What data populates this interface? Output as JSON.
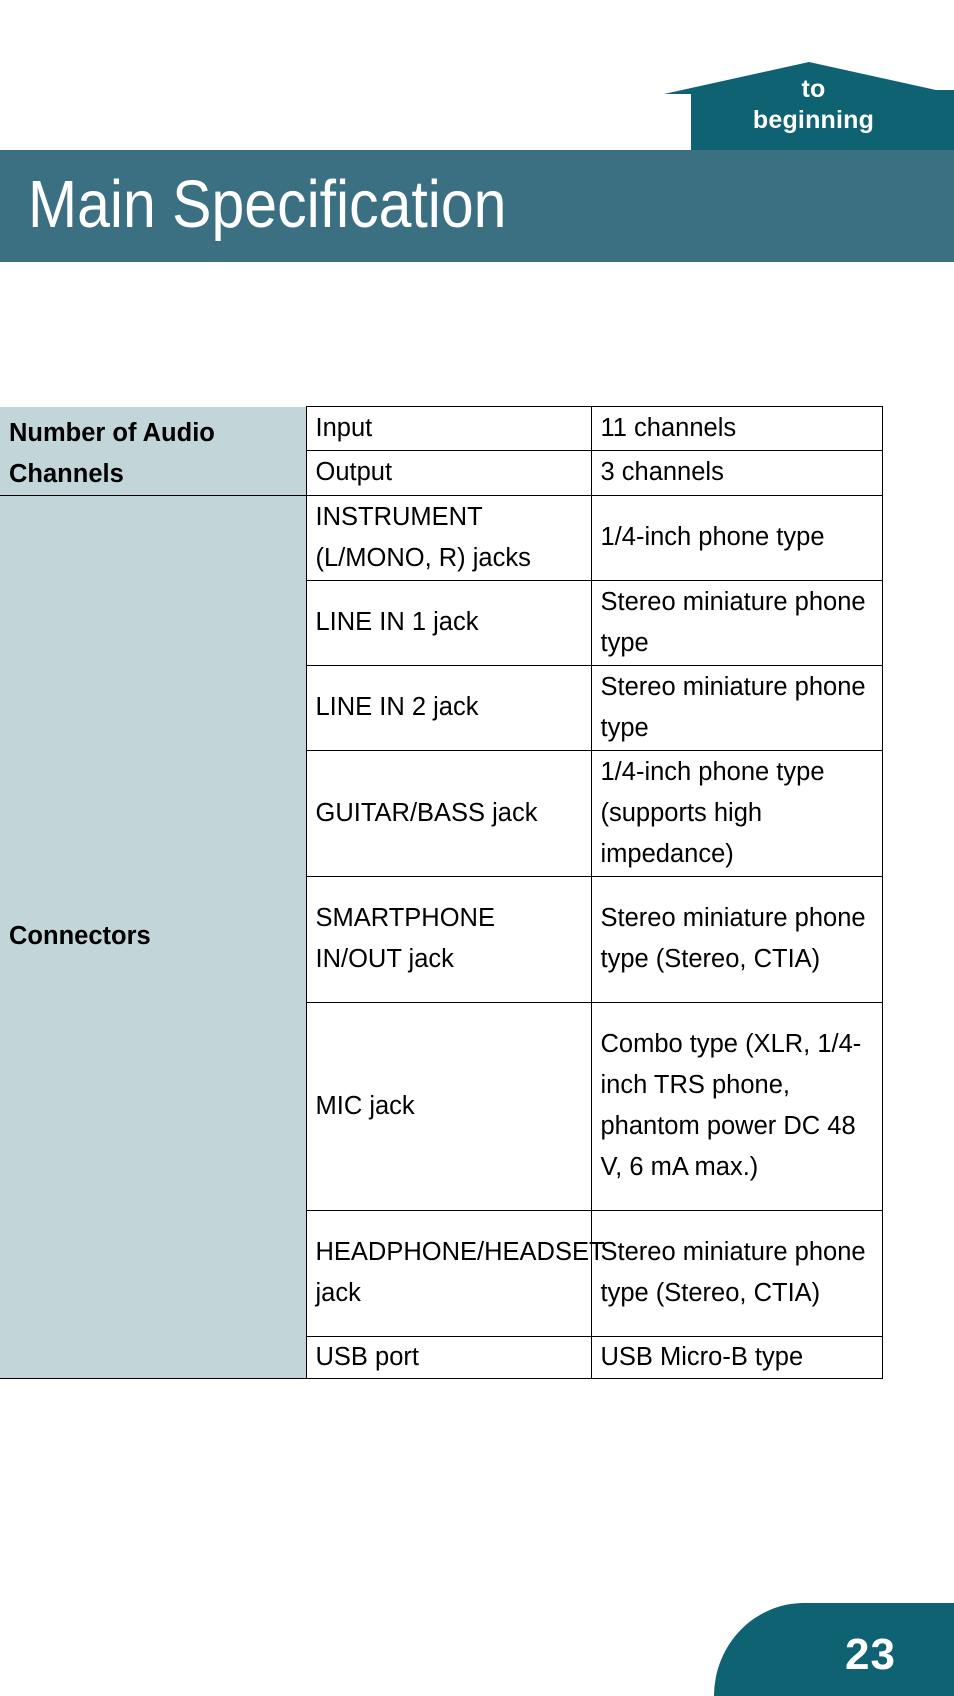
{
  "nav": {
    "home_button": {
      "line1": "to",
      "line2": "beginning",
      "icon": "home-shape",
      "color": "#0e6272"
    }
  },
  "header": {
    "title": "Main Specification",
    "banner_color": "#3b7082"
  },
  "spec_table": {
    "category_bg": "#c2d6da",
    "rows": [
      {
        "category": "Number of Audio Channels",
        "category_rowspan": 2,
        "items": [
          {
            "item": "Input",
            "value": "11 channels"
          },
          {
            "item": "Output",
            "value": "3 channels"
          }
        ]
      },
      {
        "category": "Connectors",
        "category_rowspan": 8,
        "items": [
          {
            "item": "INSTRUMENT (L/MONO, R) jacks",
            "value": "1/4-inch phone type"
          },
          {
            "item": "LINE IN 1 jack",
            "value": "Stereo miniature phone type"
          },
          {
            "item": "LINE IN 2 jack",
            "value": "Stereo miniature phone type"
          },
          {
            "item": "GUITAR/BASS jack",
            "value": "1/4-inch phone type (supports high impedance)"
          },
          {
            "item": "SMARTPHONE IN/OUT jack",
            "value": "Stereo miniature phone type (Stereo, CTIA)"
          },
          {
            "item": "MIC jack",
            "value": "Combo type (XLR, 1/4-inch TRS phone, phantom power DC 48 V, 6 mA max.)"
          },
          {
            "item": "HEADPHONE/HEADSET jack",
            "value": "Stereo miniature phone type (Stereo, CTIA)"
          },
          {
            "item": "USB port",
            "value": "USB Micro-B type"
          }
        ]
      }
    ]
  },
  "footer": {
    "page_number": "23",
    "tab_color": "#0e6272"
  }
}
